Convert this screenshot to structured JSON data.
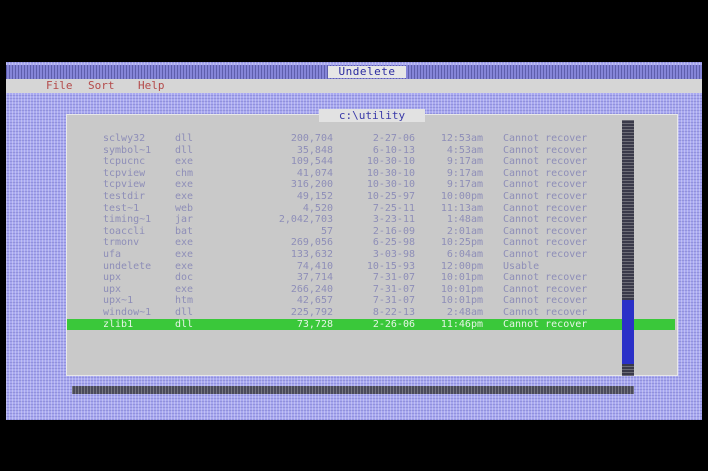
{
  "window": {
    "title": "Undelete"
  },
  "menu": [
    {
      "label": "File"
    },
    {
      "label": "Sort"
    },
    {
      "label": "Help"
    }
  ],
  "dialog": {
    "path": "c:\\utility"
  },
  "files": [
    {
      "name": "sclwy32",
      "ext": "dll",
      "size": "200,704",
      "date": "2-27-06",
      "time": "12:53am",
      "status": "Cannot recover"
    },
    {
      "name": "symbol~1",
      "ext": "dll",
      "size": "35,848",
      "date": "6-10-13",
      "time": "4:53am",
      "status": "Cannot recover"
    },
    {
      "name": "tcpucnc",
      "ext": "exe",
      "size": "109,544",
      "date": "10-30-10",
      "time": "9:17am",
      "status": "Cannot recover"
    },
    {
      "name": "tcpview",
      "ext": "chm",
      "size": "41,074",
      "date": "10-30-10",
      "time": "9:17am",
      "status": "Cannot recover"
    },
    {
      "name": "tcpview",
      "ext": "exe",
      "size": "316,200",
      "date": "10-30-10",
      "time": "9:17am",
      "status": "Cannot recover"
    },
    {
      "name": "testdir",
      "ext": "exe",
      "size": "49,152",
      "date": "10-25-97",
      "time": "10:00pm",
      "status": "Cannot recover"
    },
    {
      "name": "test~1",
      "ext": "web",
      "size": "4,520",
      "date": "7-25-11",
      "time": "11:13am",
      "status": "Cannot recover"
    },
    {
      "name": "timing~1",
      "ext": "jar",
      "size": "2,042,703",
      "date": "3-23-11",
      "time": "1:48am",
      "status": "Cannot recover"
    },
    {
      "name": "toaccli",
      "ext": "bat",
      "size": "57",
      "date": "2-16-09",
      "time": "2:01am",
      "status": "Cannot recover"
    },
    {
      "name": "trmonv",
      "ext": "exe",
      "size": "269,056",
      "date": "6-25-98",
      "time": "10:25pm",
      "status": "Cannot recover"
    },
    {
      "name": "ufa",
      "ext": "exe",
      "size": "133,632",
      "date": "3-03-98",
      "time": "6:04am",
      "status": "Cannot recover"
    },
    {
      "name": "undelete",
      "ext": "exe",
      "size": "74,410",
      "date": "10-15-93",
      "time": "12:00pm",
      "status": "Usable"
    },
    {
      "name": "upx",
      "ext": "doc",
      "size": "37,714",
      "date": "7-31-07",
      "time": "10:01pm",
      "status": "Cannot recover"
    },
    {
      "name": "upx",
      "ext": "exe",
      "size": "266,240",
      "date": "7-31-07",
      "time": "10:01pm",
      "status": "Cannot recover"
    },
    {
      "name": "upx~1",
      "ext": "htm",
      "size": "42,657",
      "date": "7-31-07",
      "time": "10:01pm",
      "status": "Cannot recover"
    },
    {
      "name": "window~1",
      "ext": "dll",
      "size": "225,792",
      "date": "8-22-13",
      "time": "2:48am",
      "status": "Cannot recover"
    },
    {
      "name": "zlib1",
      "ext": "dll",
      "size": "73,728",
      "date": "2-26-06",
      "time": "11:46pm",
      "status": "Cannot recover"
    }
  ],
  "selected_index": 16,
  "colors": {
    "background": "#a8a8f0",
    "dialog": "#c9c9c9",
    "selection": "#3ac83a",
    "text": "#8e8eb8",
    "scroll_thumb": "#2a30c8"
  }
}
